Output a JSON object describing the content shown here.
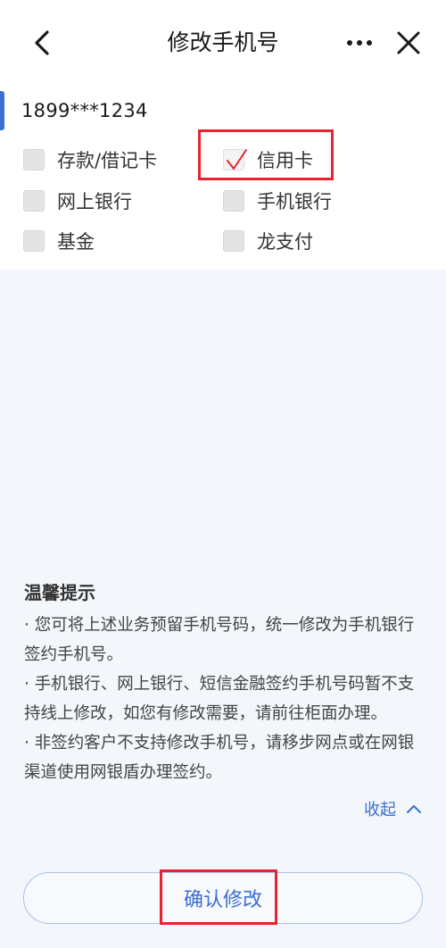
{
  "header": {
    "title": "修改手机号"
  },
  "account": {
    "phone_masked": "1899***1234"
  },
  "options": [
    {
      "label": "存款/借记卡",
      "checked": false
    },
    {
      "label": "信用卡",
      "checked": true
    },
    {
      "label": "网上银行",
      "checked": false
    },
    {
      "label": "手机银行",
      "checked": false
    },
    {
      "label": "基金",
      "checked": false
    },
    {
      "label": "龙支付",
      "checked": false
    }
  ],
  "tips": {
    "title": "温馨提示",
    "line1": "· 您可将上述业务预留手机号码，统一修改为手机银行",
    "line2": "签约手机号。",
    "line3": "· 手机银行、网上银行、短信金融签约手机号码暂不支",
    "line4": "持线上修改，如您有修改需要，请前往柜面办理。",
    "line5": "· 非签约客户不支持修改手机号，请移步网点或在网银",
    "line6": "渠道使用网银盾办理签约。",
    "collapse_label": "收起"
  },
  "footer": {
    "confirm_label": "确认修改"
  },
  "colors": {
    "accent": "#3b6fd1",
    "highlight": "#e8232d",
    "check": "#e8232d"
  },
  "icons": {
    "back": "chevron-left-icon",
    "more": "more-dots-icon",
    "close": "close-icon",
    "collapse": "chevron-up-icon",
    "check": "check-icon"
  }
}
